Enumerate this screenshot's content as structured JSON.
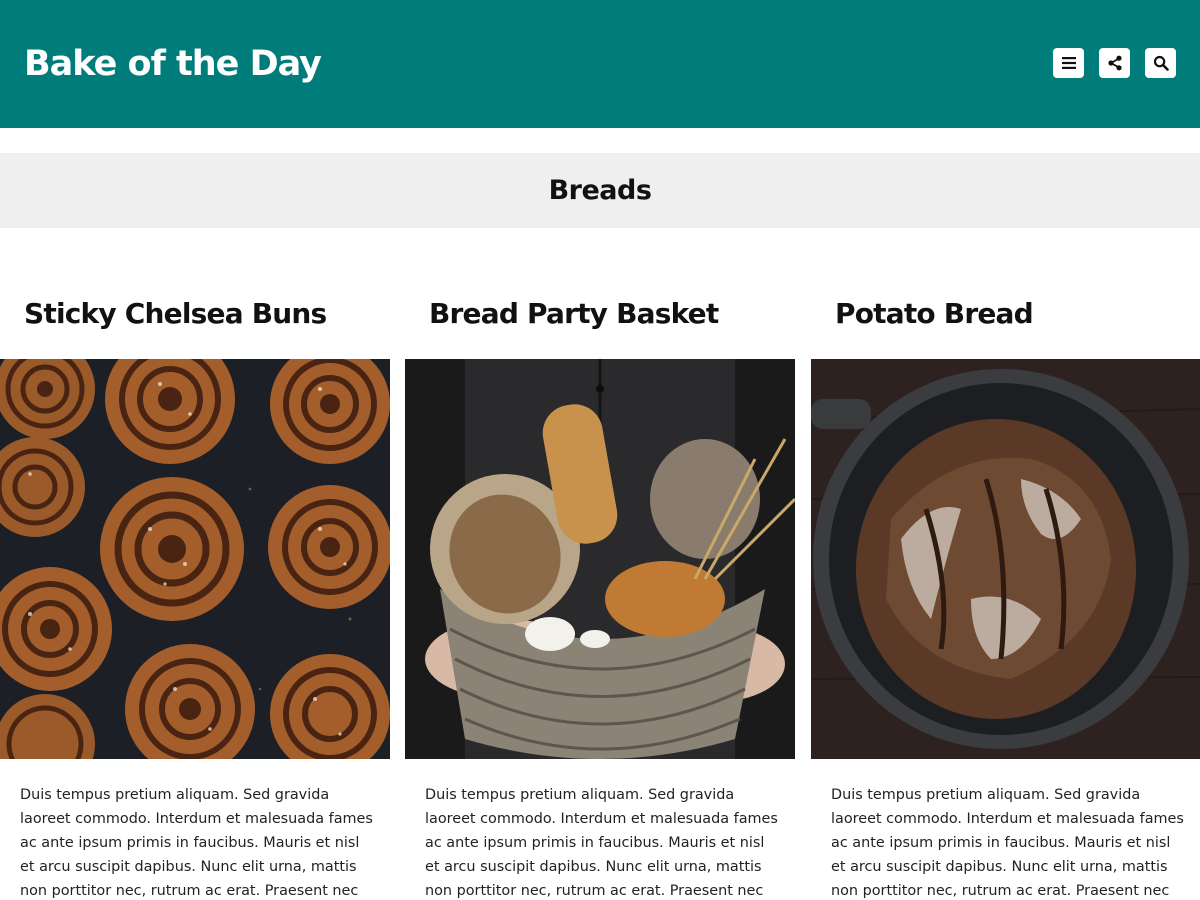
{
  "header": {
    "site_title": "Bake of the Day",
    "background_color": "#007d7b",
    "buttons": [
      {
        "icon": "menu-icon"
      },
      {
        "icon": "share-icon"
      },
      {
        "icon": "search-icon"
      }
    ]
  },
  "category": {
    "title": "Breads",
    "bar_color": "#efefef"
  },
  "posts": [
    {
      "title": "Sticky Chelsea Buns",
      "image": "cinnamon-buns-photo",
      "excerpt": "Duis tempus pretium aliquam. Sed gravida laoreet commodo. Interdum et malesuada fames ac ante ipsum primis in faucibus. Mauris et nisl et arcu suscipit dapibus. Nunc elit urna, mattis non porttitor nec, rutrum ac erat. Praesent nec lectus"
    },
    {
      "title": "Bread Party Basket",
      "image": "bread-basket-photo",
      "excerpt": "Duis tempus pretium aliquam. Sed gravida laoreet commodo. Interdum et malesuada fames ac ante ipsum primis in faucibus. Mauris et nisl et arcu suscipit dapibus. Nunc elit urna, mattis non porttitor nec, rutrum ac erat. Praesent nec lectus"
    },
    {
      "title": "Potato Bread",
      "image": "potato-bread-photo",
      "excerpt": "Duis tempus pretium aliquam. Sed gravida laoreet commodo. Interdum et malesuada fames ac ante ipsum primis in faucibus. Mauris et nisl et arcu suscipit dapibus. Nunc elit urna, mattis non porttitor nec, rutrum ac erat. Praesent nec lectus"
    }
  ]
}
